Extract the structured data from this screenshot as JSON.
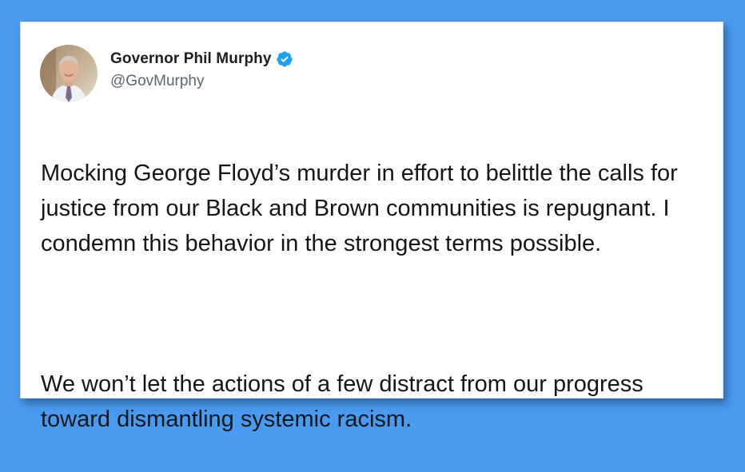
{
  "tweet": {
    "author": {
      "display_name": "Governor Phil Murphy",
      "handle": "@GovMurphy",
      "verified": true,
      "verified_icon": "verified-badge-icon",
      "avatar": "profile-photo"
    },
    "paragraphs": [
      "Mocking George Floyd’s murder in effort to belittle the calls for justice from our Black and Brown communities is repugnant. I condemn this behavior in the strongest terms possible.",
      "We won’t let the actions of a few distract from our progress toward dismantling systemic racism."
    ]
  },
  "colors": {
    "background": "#4a9af0",
    "card": "#ffffff",
    "verified": "#1da1f2",
    "text": "#14171a",
    "handle": "#5b6670"
  }
}
